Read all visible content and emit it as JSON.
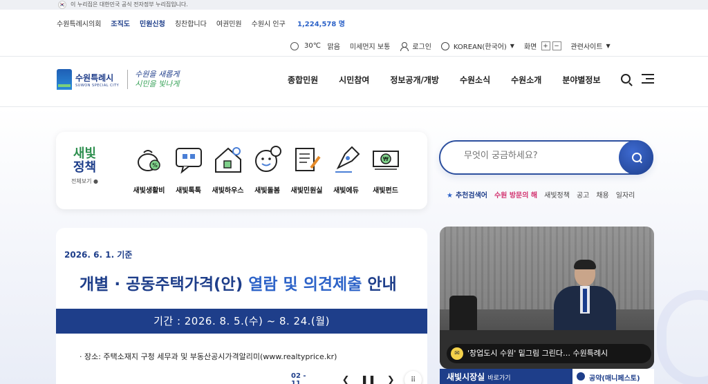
{
  "gov_banner": {
    "flag": "🇰🇷",
    "text": "이 누리집은 대한민국 공식 전자정부 누리집입니다."
  },
  "util_links": {
    "council": "수원특례시의회",
    "org": "조직도",
    "civil": "민원신청",
    "praise": "칭찬합니다",
    "passport": "여권민원",
    "pop_label": "수원시 인구",
    "pop_value": "1,224,578 명"
  },
  "util_right": {
    "temp": "30℃",
    "weather": "맑음",
    "dust": "미세먼지 보통",
    "login": "로그인",
    "language": "KOREAN(한국어)",
    "screen": "화면",
    "zoom_in": "+",
    "zoom_out": "−",
    "related": "관련사이트"
  },
  "logo": {
    "kr": "수원특례시",
    "en": "SUWON SPECIAL CITY",
    "slogan_1": "수원을 새롭게",
    "slogan_2": "시민을 빛나게"
  },
  "gnb": [
    "종합민원",
    "시민참여",
    "정보공개/개방",
    "수원소식",
    "수원소개",
    "분야별정보"
  ],
  "policy": {
    "title_1": "새빛",
    "title_2": "정책",
    "more": "전체보기 ●",
    "items": [
      "새빛생활비",
      "새빛톡톡",
      "새빛하우스",
      "새빛돌봄",
      "새빛민원실",
      "새빛에듀",
      "새빛펀드"
    ]
  },
  "search": {
    "placeholder": "무엇이 궁금하세요?"
  },
  "keywords": {
    "label": "추천검색어",
    "items": [
      "수원 방문의 해",
      "새빛정책",
      "공고",
      "채용",
      "일자리"
    ]
  },
  "notice": {
    "date": "2026. 6. 1. 기준",
    "headline_1": "개별 · 공동주택가격(안) ",
    "headline_2": "열람 및 의견제출",
    "headline_3": " 안내",
    "period": "기간  :  2026. 8. 5.(수) ~ 8. 24.(월)",
    "place": "· 장소: 주택소재지 구청 세무과 및 부동산공시가격알리미(www.realtyprice.kr)",
    "pager": "02 - 11"
  },
  "photo": {
    "caption": "'창업도시 수원' 밑그림 그린다… 수원특례시"
  },
  "bottom": {
    "left": "새빛시장실",
    "left_small": "바로가기",
    "right": "공약(매니페스토)"
  }
}
